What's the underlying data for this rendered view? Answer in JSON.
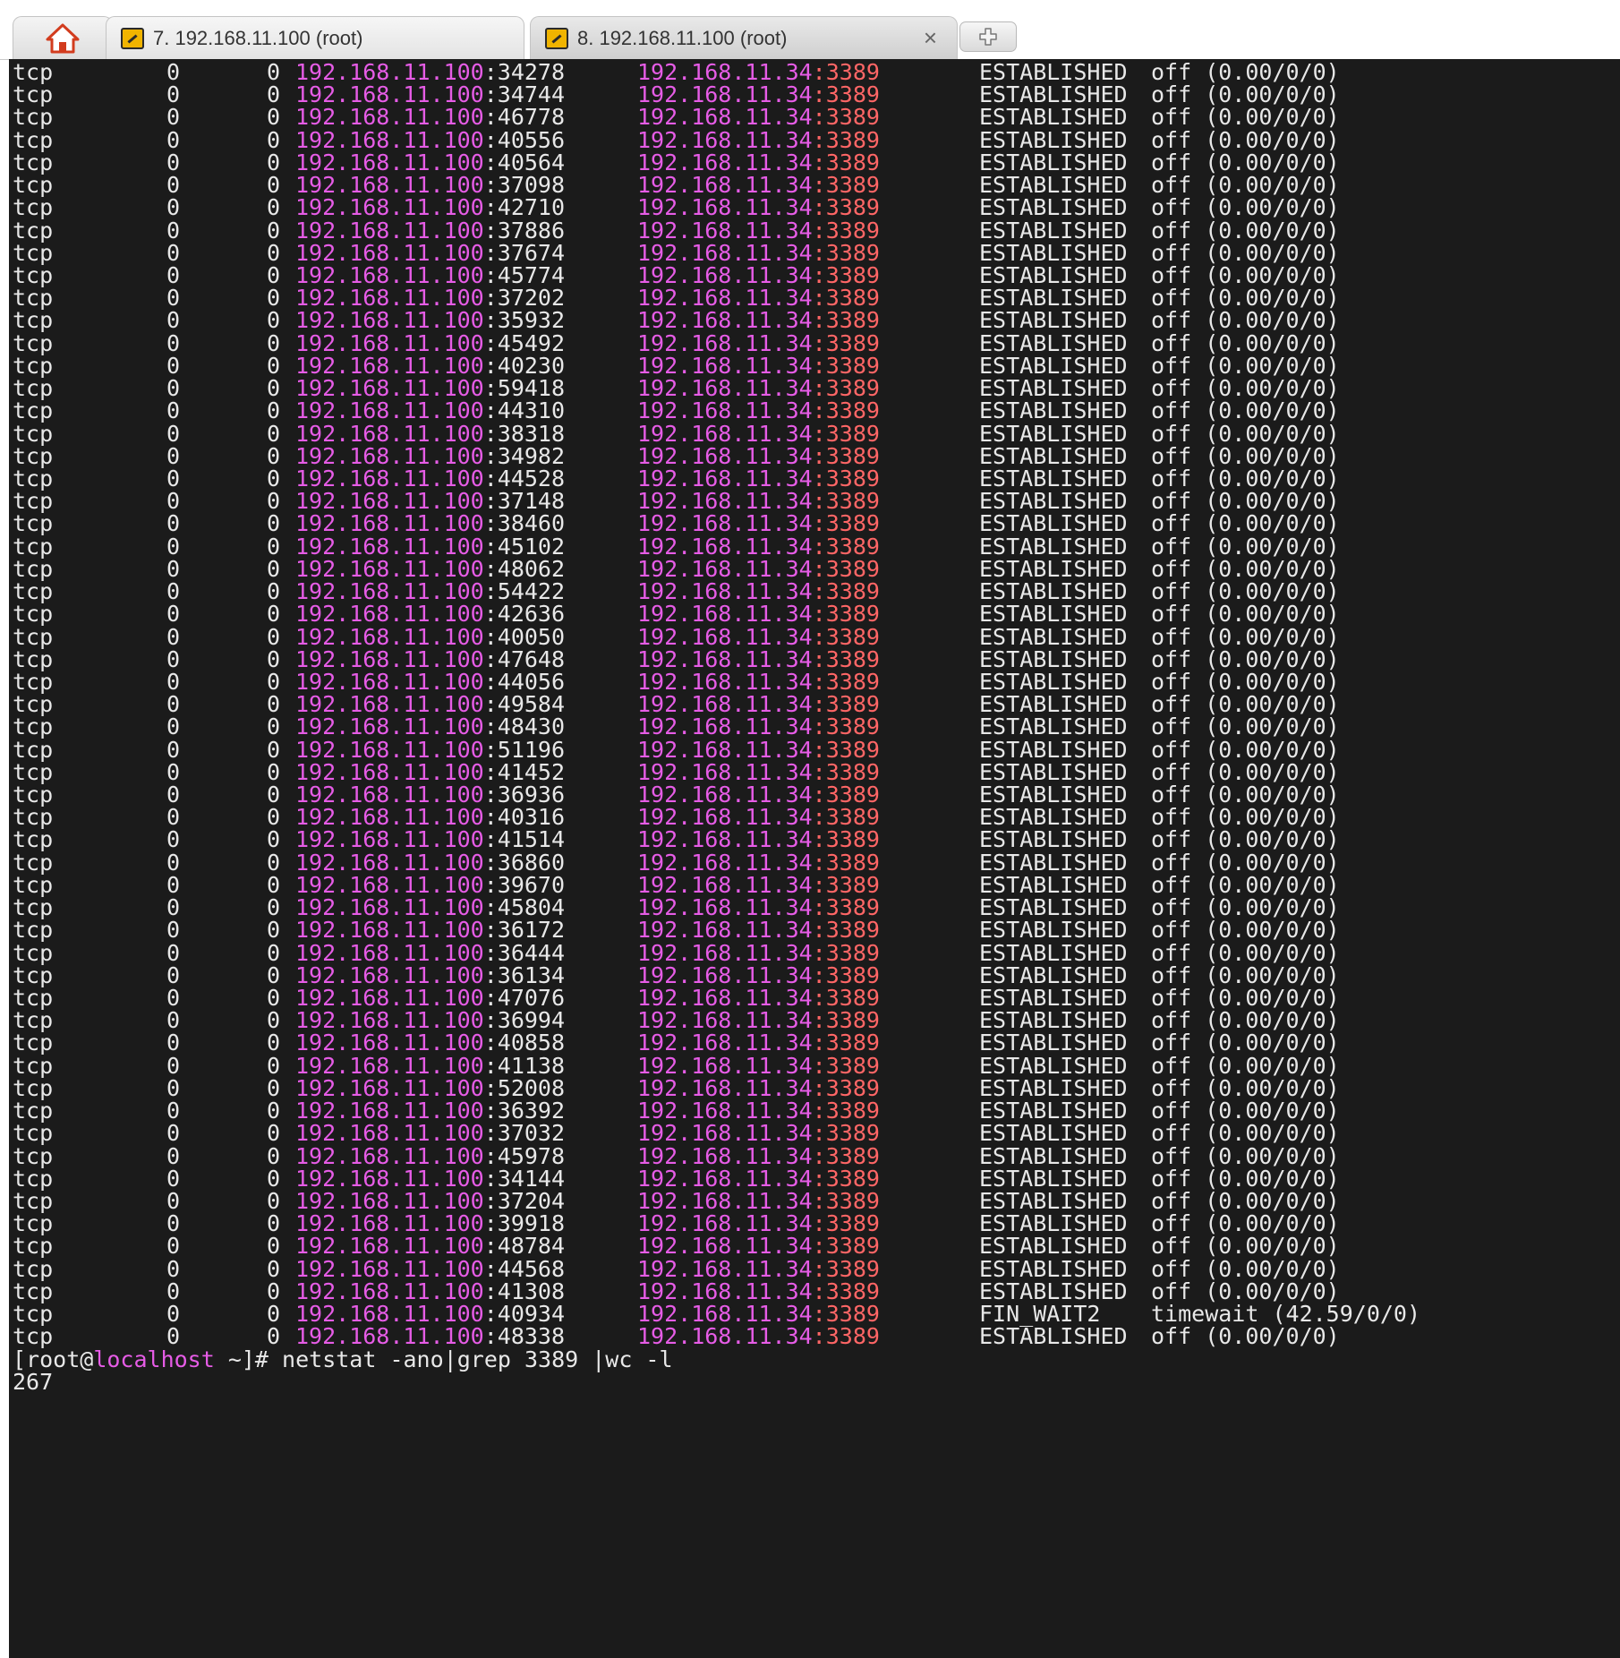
{
  "tabs": [
    {
      "label": "7. 192.168.11.100 (root)",
      "active": false
    },
    {
      "label": "8. 192.168.11.100 (root)",
      "active": true,
      "close": "×"
    }
  ],
  "colors": {
    "terminal_bg": "#1b1b1b",
    "ip_magenta": "#e65ce6",
    "port_red": "#ff6666",
    "text": "#e8e8e8"
  },
  "icons": {
    "home": "home-icon",
    "session": "key-icon",
    "new_tab": "plus-icon",
    "close": "close-icon"
  },
  "rows": [
    {
      "proto": "tcp",
      "recvq": "0",
      "sendq": "0",
      "local_ip": "192.168.11.100",
      "local_port": ":34278",
      "foreign_ip": "192.168.11.34",
      "foreign_port": ":3389",
      "state": "ESTABLISHED",
      "timer": "off (0.00/0/0)"
    },
    {
      "proto": "tcp",
      "recvq": "0",
      "sendq": "0",
      "local_ip": "192.168.11.100",
      "local_port": ":34744",
      "foreign_ip": "192.168.11.34",
      "foreign_port": ":3389",
      "state": "ESTABLISHED",
      "timer": "off (0.00/0/0)"
    },
    {
      "proto": "tcp",
      "recvq": "0",
      "sendq": "0",
      "local_ip": "192.168.11.100",
      "local_port": ":46778",
      "foreign_ip": "192.168.11.34",
      "foreign_port": ":3389",
      "state": "ESTABLISHED",
      "timer": "off (0.00/0/0)"
    },
    {
      "proto": "tcp",
      "recvq": "0",
      "sendq": "0",
      "local_ip": "192.168.11.100",
      "local_port": ":40556",
      "foreign_ip": "192.168.11.34",
      "foreign_port": ":3389",
      "state": "ESTABLISHED",
      "timer": "off (0.00/0/0)"
    },
    {
      "proto": "tcp",
      "recvq": "0",
      "sendq": "0",
      "local_ip": "192.168.11.100",
      "local_port": ":40564",
      "foreign_ip": "192.168.11.34",
      "foreign_port": ":3389",
      "state": "ESTABLISHED",
      "timer": "off (0.00/0/0)"
    },
    {
      "proto": "tcp",
      "recvq": "0",
      "sendq": "0",
      "local_ip": "192.168.11.100",
      "local_port": ":37098",
      "foreign_ip": "192.168.11.34",
      "foreign_port": ":3389",
      "state": "ESTABLISHED",
      "timer": "off (0.00/0/0)"
    },
    {
      "proto": "tcp",
      "recvq": "0",
      "sendq": "0",
      "local_ip": "192.168.11.100",
      "local_port": ":42710",
      "foreign_ip": "192.168.11.34",
      "foreign_port": ":3389",
      "state": "ESTABLISHED",
      "timer": "off (0.00/0/0)"
    },
    {
      "proto": "tcp",
      "recvq": "0",
      "sendq": "0",
      "local_ip": "192.168.11.100",
      "local_port": ":37886",
      "foreign_ip": "192.168.11.34",
      "foreign_port": ":3389",
      "state": "ESTABLISHED",
      "timer": "off (0.00/0/0)"
    },
    {
      "proto": "tcp",
      "recvq": "0",
      "sendq": "0",
      "local_ip": "192.168.11.100",
      "local_port": ":37674",
      "foreign_ip": "192.168.11.34",
      "foreign_port": ":3389",
      "state": "ESTABLISHED",
      "timer": "off (0.00/0/0)"
    },
    {
      "proto": "tcp",
      "recvq": "0",
      "sendq": "0",
      "local_ip": "192.168.11.100",
      "local_port": ":45774",
      "foreign_ip": "192.168.11.34",
      "foreign_port": ":3389",
      "state": "ESTABLISHED",
      "timer": "off (0.00/0/0)"
    },
    {
      "proto": "tcp",
      "recvq": "0",
      "sendq": "0",
      "local_ip": "192.168.11.100",
      "local_port": ":37202",
      "foreign_ip": "192.168.11.34",
      "foreign_port": ":3389",
      "state": "ESTABLISHED",
      "timer": "off (0.00/0/0)"
    },
    {
      "proto": "tcp",
      "recvq": "0",
      "sendq": "0",
      "local_ip": "192.168.11.100",
      "local_port": ":35932",
      "foreign_ip": "192.168.11.34",
      "foreign_port": ":3389",
      "state": "ESTABLISHED",
      "timer": "off (0.00/0/0)"
    },
    {
      "proto": "tcp",
      "recvq": "0",
      "sendq": "0",
      "local_ip": "192.168.11.100",
      "local_port": ":45492",
      "foreign_ip": "192.168.11.34",
      "foreign_port": ":3389",
      "state": "ESTABLISHED",
      "timer": "off (0.00/0/0)"
    },
    {
      "proto": "tcp",
      "recvq": "0",
      "sendq": "0",
      "local_ip": "192.168.11.100",
      "local_port": ":40230",
      "foreign_ip": "192.168.11.34",
      "foreign_port": ":3389",
      "state": "ESTABLISHED",
      "timer": "off (0.00/0/0)"
    },
    {
      "proto": "tcp",
      "recvq": "0",
      "sendq": "0",
      "local_ip": "192.168.11.100",
      "local_port": ":59418",
      "foreign_ip": "192.168.11.34",
      "foreign_port": ":3389",
      "state": "ESTABLISHED",
      "timer": "off (0.00/0/0)"
    },
    {
      "proto": "tcp",
      "recvq": "0",
      "sendq": "0",
      "local_ip": "192.168.11.100",
      "local_port": ":44310",
      "foreign_ip": "192.168.11.34",
      "foreign_port": ":3389",
      "state": "ESTABLISHED",
      "timer": "off (0.00/0/0)"
    },
    {
      "proto": "tcp",
      "recvq": "0",
      "sendq": "0",
      "local_ip": "192.168.11.100",
      "local_port": ":38318",
      "foreign_ip": "192.168.11.34",
      "foreign_port": ":3389",
      "state": "ESTABLISHED",
      "timer": "off (0.00/0/0)"
    },
    {
      "proto": "tcp",
      "recvq": "0",
      "sendq": "0",
      "local_ip": "192.168.11.100",
      "local_port": ":34982",
      "foreign_ip": "192.168.11.34",
      "foreign_port": ":3389",
      "state": "ESTABLISHED",
      "timer": "off (0.00/0/0)"
    },
    {
      "proto": "tcp",
      "recvq": "0",
      "sendq": "0",
      "local_ip": "192.168.11.100",
      "local_port": ":44528",
      "foreign_ip": "192.168.11.34",
      "foreign_port": ":3389",
      "state": "ESTABLISHED",
      "timer": "off (0.00/0/0)"
    },
    {
      "proto": "tcp",
      "recvq": "0",
      "sendq": "0",
      "local_ip": "192.168.11.100",
      "local_port": ":37148",
      "foreign_ip": "192.168.11.34",
      "foreign_port": ":3389",
      "state": "ESTABLISHED",
      "timer": "off (0.00/0/0)"
    },
    {
      "proto": "tcp",
      "recvq": "0",
      "sendq": "0",
      "local_ip": "192.168.11.100",
      "local_port": ":38460",
      "foreign_ip": "192.168.11.34",
      "foreign_port": ":3389",
      "state": "ESTABLISHED",
      "timer": "off (0.00/0/0)"
    },
    {
      "proto": "tcp",
      "recvq": "0",
      "sendq": "0",
      "local_ip": "192.168.11.100",
      "local_port": ":45102",
      "foreign_ip": "192.168.11.34",
      "foreign_port": ":3389",
      "state": "ESTABLISHED",
      "timer": "off (0.00/0/0)"
    },
    {
      "proto": "tcp",
      "recvq": "0",
      "sendq": "0",
      "local_ip": "192.168.11.100",
      "local_port": ":48062",
      "foreign_ip": "192.168.11.34",
      "foreign_port": ":3389",
      "state": "ESTABLISHED",
      "timer": "off (0.00/0/0)"
    },
    {
      "proto": "tcp",
      "recvq": "0",
      "sendq": "0",
      "local_ip": "192.168.11.100",
      "local_port": ":54422",
      "foreign_ip": "192.168.11.34",
      "foreign_port": ":3389",
      "state": "ESTABLISHED",
      "timer": "off (0.00/0/0)"
    },
    {
      "proto": "tcp",
      "recvq": "0",
      "sendq": "0",
      "local_ip": "192.168.11.100",
      "local_port": ":42636",
      "foreign_ip": "192.168.11.34",
      "foreign_port": ":3389",
      "state": "ESTABLISHED",
      "timer": "off (0.00/0/0)"
    },
    {
      "proto": "tcp",
      "recvq": "0",
      "sendq": "0",
      "local_ip": "192.168.11.100",
      "local_port": ":40050",
      "foreign_ip": "192.168.11.34",
      "foreign_port": ":3389",
      "state": "ESTABLISHED",
      "timer": "off (0.00/0/0)"
    },
    {
      "proto": "tcp",
      "recvq": "0",
      "sendq": "0",
      "local_ip": "192.168.11.100",
      "local_port": ":47648",
      "foreign_ip": "192.168.11.34",
      "foreign_port": ":3389",
      "state": "ESTABLISHED",
      "timer": "off (0.00/0/0)"
    },
    {
      "proto": "tcp",
      "recvq": "0",
      "sendq": "0",
      "local_ip": "192.168.11.100",
      "local_port": ":44056",
      "foreign_ip": "192.168.11.34",
      "foreign_port": ":3389",
      "state": "ESTABLISHED",
      "timer": "off (0.00/0/0)"
    },
    {
      "proto": "tcp",
      "recvq": "0",
      "sendq": "0",
      "local_ip": "192.168.11.100",
      "local_port": ":49584",
      "foreign_ip": "192.168.11.34",
      "foreign_port": ":3389",
      "state": "ESTABLISHED",
      "timer": "off (0.00/0/0)"
    },
    {
      "proto": "tcp",
      "recvq": "0",
      "sendq": "0",
      "local_ip": "192.168.11.100",
      "local_port": ":48430",
      "foreign_ip": "192.168.11.34",
      "foreign_port": ":3389",
      "state": "ESTABLISHED",
      "timer": "off (0.00/0/0)"
    },
    {
      "proto": "tcp",
      "recvq": "0",
      "sendq": "0",
      "local_ip": "192.168.11.100",
      "local_port": ":51196",
      "foreign_ip": "192.168.11.34",
      "foreign_port": ":3389",
      "state": "ESTABLISHED",
      "timer": "off (0.00/0/0)"
    },
    {
      "proto": "tcp",
      "recvq": "0",
      "sendq": "0",
      "local_ip": "192.168.11.100",
      "local_port": ":41452",
      "foreign_ip": "192.168.11.34",
      "foreign_port": ":3389",
      "state": "ESTABLISHED",
      "timer": "off (0.00/0/0)"
    },
    {
      "proto": "tcp",
      "recvq": "0",
      "sendq": "0",
      "local_ip": "192.168.11.100",
      "local_port": ":36936",
      "foreign_ip": "192.168.11.34",
      "foreign_port": ":3389",
      "state": "ESTABLISHED",
      "timer": "off (0.00/0/0)"
    },
    {
      "proto": "tcp",
      "recvq": "0",
      "sendq": "0",
      "local_ip": "192.168.11.100",
      "local_port": ":40316",
      "foreign_ip": "192.168.11.34",
      "foreign_port": ":3389",
      "state": "ESTABLISHED",
      "timer": "off (0.00/0/0)"
    },
    {
      "proto": "tcp",
      "recvq": "0",
      "sendq": "0",
      "local_ip": "192.168.11.100",
      "local_port": ":41514",
      "foreign_ip": "192.168.11.34",
      "foreign_port": ":3389",
      "state": "ESTABLISHED",
      "timer": "off (0.00/0/0)"
    },
    {
      "proto": "tcp",
      "recvq": "0",
      "sendq": "0",
      "local_ip": "192.168.11.100",
      "local_port": ":36860",
      "foreign_ip": "192.168.11.34",
      "foreign_port": ":3389",
      "state": "ESTABLISHED",
      "timer": "off (0.00/0/0)"
    },
    {
      "proto": "tcp",
      "recvq": "0",
      "sendq": "0",
      "local_ip": "192.168.11.100",
      "local_port": ":39670",
      "foreign_ip": "192.168.11.34",
      "foreign_port": ":3389",
      "state": "ESTABLISHED",
      "timer": "off (0.00/0/0)"
    },
    {
      "proto": "tcp",
      "recvq": "0",
      "sendq": "0",
      "local_ip": "192.168.11.100",
      "local_port": ":45804",
      "foreign_ip": "192.168.11.34",
      "foreign_port": ":3389",
      "state": "ESTABLISHED",
      "timer": "off (0.00/0/0)"
    },
    {
      "proto": "tcp",
      "recvq": "0",
      "sendq": "0",
      "local_ip": "192.168.11.100",
      "local_port": ":36172",
      "foreign_ip": "192.168.11.34",
      "foreign_port": ":3389",
      "state": "ESTABLISHED",
      "timer": "off (0.00/0/0)"
    },
    {
      "proto": "tcp",
      "recvq": "0",
      "sendq": "0",
      "local_ip": "192.168.11.100",
      "local_port": ":36444",
      "foreign_ip": "192.168.11.34",
      "foreign_port": ":3389",
      "state": "ESTABLISHED",
      "timer": "off (0.00/0/0)"
    },
    {
      "proto": "tcp",
      "recvq": "0",
      "sendq": "0",
      "local_ip": "192.168.11.100",
      "local_port": ":36134",
      "foreign_ip": "192.168.11.34",
      "foreign_port": ":3389",
      "state": "ESTABLISHED",
      "timer": "off (0.00/0/0)"
    },
    {
      "proto": "tcp",
      "recvq": "0",
      "sendq": "0",
      "local_ip": "192.168.11.100",
      "local_port": ":47076",
      "foreign_ip": "192.168.11.34",
      "foreign_port": ":3389",
      "state": "ESTABLISHED",
      "timer": "off (0.00/0/0)"
    },
    {
      "proto": "tcp",
      "recvq": "0",
      "sendq": "0",
      "local_ip": "192.168.11.100",
      "local_port": ":36994",
      "foreign_ip": "192.168.11.34",
      "foreign_port": ":3389",
      "state": "ESTABLISHED",
      "timer": "off (0.00/0/0)"
    },
    {
      "proto": "tcp",
      "recvq": "0",
      "sendq": "0",
      "local_ip": "192.168.11.100",
      "local_port": ":40858",
      "foreign_ip": "192.168.11.34",
      "foreign_port": ":3389",
      "state": "ESTABLISHED",
      "timer": "off (0.00/0/0)"
    },
    {
      "proto": "tcp",
      "recvq": "0",
      "sendq": "0",
      "local_ip": "192.168.11.100",
      "local_port": ":41138",
      "foreign_ip": "192.168.11.34",
      "foreign_port": ":3389",
      "state": "ESTABLISHED",
      "timer": "off (0.00/0/0)"
    },
    {
      "proto": "tcp",
      "recvq": "0",
      "sendq": "0",
      "local_ip": "192.168.11.100",
      "local_port": ":52008",
      "foreign_ip": "192.168.11.34",
      "foreign_port": ":3389",
      "state": "ESTABLISHED",
      "timer": "off (0.00/0/0)"
    },
    {
      "proto": "tcp",
      "recvq": "0",
      "sendq": "0",
      "local_ip": "192.168.11.100",
      "local_port": ":36392",
      "foreign_ip": "192.168.11.34",
      "foreign_port": ":3389",
      "state": "ESTABLISHED",
      "timer": "off (0.00/0/0)"
    },
    {
      "proto": "tcp",
      "recvq": "0",
      "sendq": "0",
      "local_ip": "192.168.11.100",
      "local_port": ":37032",
      "foreign_ip": "192.168.11.34",
      "foreign_port": ":3389",
      "state": "ESTABLISHED",
      "timer": "off (0.00/0/0)"
    },
    {
      "proto": "tcp",
      "recvq": "0",
      "sendq": "0",
      "local_ip": "192.168.11.100",
      "local_port": ":45978",
      "foreign_ip": "192.168.11.34",
      "foreign_port": ":3389",
      "state": "ESTABLISHED",
      "timer": "off (0.00/0/0)"
    },
    {
      "proto": "tcp",
      "recvq": "0",
      "sendq": "0",
      "local_ip": "192.168.11.100",
      "local_port": ":34144",
      "foreign_ip": "192.168.11.34",
      "foreign_port": ":3389",
      "state": "ESTABLISHED",
      "timer": "off (0.00/0/0)"
    },
    {
      "proto": "tcp",
      "recvq": "0",
      "sendq": "0",
      "local_ip": "192.168.11.100",
      "local_port": ":37204",
      "foreign_ip": "192.168.11.34",
      "foreign_port": ":3389",
      "state": "ESTABLISHED",
      "timer": "off (0.00/0/0)"
    },
    {
      "proto": "tcp",
      "recvq": "0",
      "sendq": "0",
      "local_ip": "192.168.11.100",
      "local_port": ":39918",
      "foreign_ip": "192.168.11.34",
      "foreign_port": ":3389",
      "state": "ESTABLISHED",
      "timer": "off (0.00/0/0)"
    },
    {
      "proto": "tcp",
      "recvq": "0",
      "sendq": "0",
      "local_ip": "192.168.11.100",
      "local_port": ":48784",
      "foreign_ip": "192.168.11.34",
      "foreign_port": ":3389",
      "state": "ESTABLISHED",
      "timer": "off (0.00/0/0)"
    },
    {
      "proto": "tcp",
      "recvq": "0",
      "sendq": "0",
      "local_ip": "192.168.11.100",
      "local_port": ":44568",
      "foreign_ip": "192.168.11.34",
      "foreign_port": ":3389",
      "state": "ESTABLISHED",
      "timer": "off (0.00/0/0)"
    },
    {
      "proto": "tcp",
      "recvq": "0",
      "sendq": "0",
      "local_ip": "192.168.11.100",
      "local_port": ":41308",
      "foreign_ip": "192.168.11.34",
      "foreign_port": ":3389",
      "state": "ESTABLISHED",
      "timer": "off (0.00/0/0)"
    },
    {
      "proto": "tcp",
      "recvq": "0",
      "sendq": "0",
      "local_ip": "192.168.11.100",
      "local_port": ":40934",
      "foreign_ip": "192.168.11.34",
      "foreign_port": ":3389",
      "state": "FIN_WAIT2",
      "timer": "timewait (42.59/0/0)"
    },
    {
      "proto": "tcp",
      "recvq": "0",
      "sendq": "0",
      "local_ip": "192.168.11.100",
      "local_port": ":48338",
      "foreign_ip": "192.168.11.34",
      "foreign_port": ":3389",
      "state": "ESTABLISHED",
      "timer": "off (0.00/0/0)"
    }
  ],
  "prompt": {
    "prefix": "[root@",
    "host": "localhost",
    "suffix": " ~]# ",
    "command": "netstat -ano|grep 3389 |wc -l"
  },
  "output": "267"
}
